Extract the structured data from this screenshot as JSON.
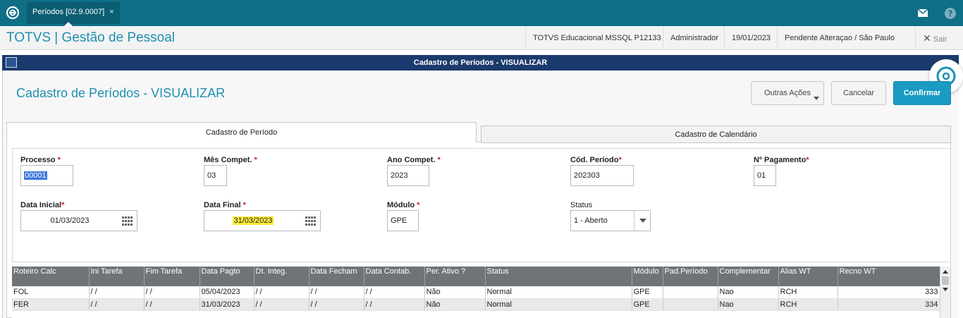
{
  "topbar": {
    "tab_label": "Períodos [02.9.0007]",
    "tab_close": "×"
  },
  "header": {
    "app_title": "TOTVS | Gestão de Pessoal",
    "environment": "TOTVS Educacional MSSQL P12133",
    "user": "Administrador",
    "date": "19/01/2023",
    "branch": "Pendente Alteraçao / São Paulo",
    "exit_label": "Sair"
  },
  "window": {
    "title": "Cadastro de Períodos - VISUALIZAR"
  },
  "form": {
    "title": "Cadastro de Períodos - VISUALIZAR",
    "btn_other": "Outras Ações",
    "btn_cancel": "Cancelar",
    "btn_confirm": "Confirmar"
  },
  "tabs": {
    "periodo": "Cadastro de Período",
    "calendario": "Cadastro de Calendário"
  },
  "fields": {
    "processo": {
      "label": "Processo",
      "value": "00001"
    },
    "mes": {
      "label": "Mês Compet.",
      "value": "03"
    },
    "ano": {
      "label": "Ano Compet.",
      "value": "2023"
    },
    "cod_periodo": {
      "label": "Cód. Período",
      "value": "202303"
    },
    "num_pagamento": {
      "label": "Nº Pagamento",
      "value": "01"
    },
    "data_inicial": {
      "label": "Data Inicial",
      "value": "01/03/2023"
    },
    "data_final": {
      "label": "Data Final",
      "value": "31/03/2023"
    },
    "modulo": {
      "label": "Módulo",
      "value": "GPE"
    },
    "status": {
      "label": "Status",
      "value": "1 - Aberto"
    },
    "required_mark": "*"
  },
  "grid": {
    "columns": [
      "Roteiro Calc",
      "Ini Tarefa",
      "Fim Tarefa",
      "Data Pagto",
      "Dt. Integ.",
      "Data Fecham",
      "Data Contab.",
      "Per. Ativo ?",
      "Status",
      "Módulo",
      "Pad.Período",
      "Complementar",
      "Alias WT",
      "Recno WT"
    ],
    "rows": [
      [
        "FOL",
        " / /",
        " / /",
        "05/04/2023",
        " / /",
        " / /",
        " / /",
        "Não",
        "Normal",
        "GPE",
        "",
        "Nao",
        "RCH",
        "333"
      ],
      [
        "FER",
        " / /",
        " / /",
        "31/03/2023",
        " / /",
        " / /",
        " / /",
        "Não",
        "Normal",
        "GPE",
        "",
        "Nao",
        "RCH",
        "334"
      ]
    ]
  }
}
